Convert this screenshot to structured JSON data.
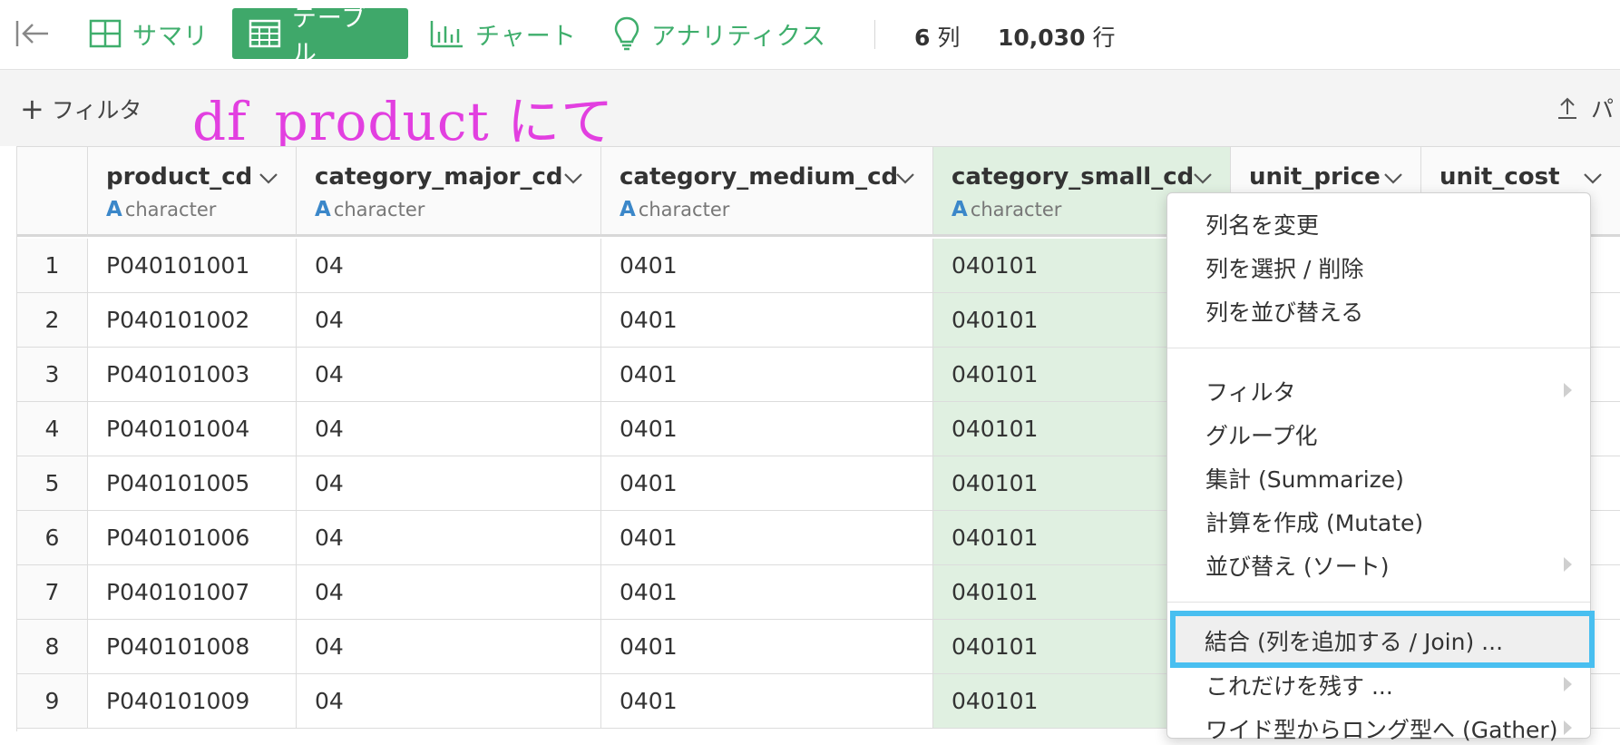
{
  "toolbar": {
    "tabs": [
      {
        "label": "サマリ",
        "icon": "summary-grid-icon"
      },
      {
        "label": "テーブル",
        "icon": "table-icon"
      },
      {
        "label": "チャート",
        "icon": "bar-chart-icon"
      },
      {
        "label": "アナリティクス",
        "icon": "lightbulb-icon"
      }
    ],
    "col_count": "6",
    "col_unit": "列",
    "row_count": "10,030",
    "row_unit": "行"
  },
  "filterbar": {
    "add_filter": "フィルタ",
    "annotation": "df_product にて",
    "export_label": "パ"
  },
  "table": {
    "columns": [
      {
        "name": "product_cd",
        "type": "character"
      },
      {
        "name": "category_major_cd",
        "type": "character"
      },
      {
        "name": "category_medium_cd",
        "type": "character"
      },
      {
        "name": "category_small_cd",
        "type": "character"
      },
      {
        "name": "unit_price",
        "type": ""
      },
      {
        "name": "unit_cost",
        "type": ""
      }
    ],
    "rows": [
      [
        "1",
        "P040101001",
        "04",
        "0401",
        "040101"
      ],
      [
        "2",
        "P040101002",
        "04",
        "0401",
        "040101"
      ],
      [
        "3",
        "P040101003",
        "04",
        "0401",
        "040101"
      ],
      [
        "4",
        "P040101004",
        "04",
        "0401",
        "040101"
      ],
      [
        "5",
        "P040101005",
        "04",
        "0401",
        "040101"
      ],
      [
        "6",
        "P040101006",
        "04",
        "0401",
        "040101"
      ],
      [
        "7",
        "P040101007",
        "04",
        "0401",
        "040101"
      ],
      [
        "8",
        "P040101008",
        "04",
        "0401",
        "040101"
      ],
      [
        "9",
        "P040101009",
        "04",
        "0401",
        "040101"
      ]
    ]
  },
  "menu": {
    "items": [
      "列名を変更",
      "列を選択 / 削除",
      "列を並び替える",
      "フィルタ",
      "グループ化",
      "集計 (Summarize)",
      "計算を作成 (Mutate)",
      "並び替え (ソート)",
      "結合 (列を追加する / Join) ...",
      "これだけを残す ...",
      "ワイド型からロング型へ (Gather)"
    ]
  },
  "colors": {
    "accent_green": "#3fa86a",
    "selected_column": "#e0f0e1",
    "highlight_box": "#49bff0",
    "annotation": "#e23fe0"
  }
}
